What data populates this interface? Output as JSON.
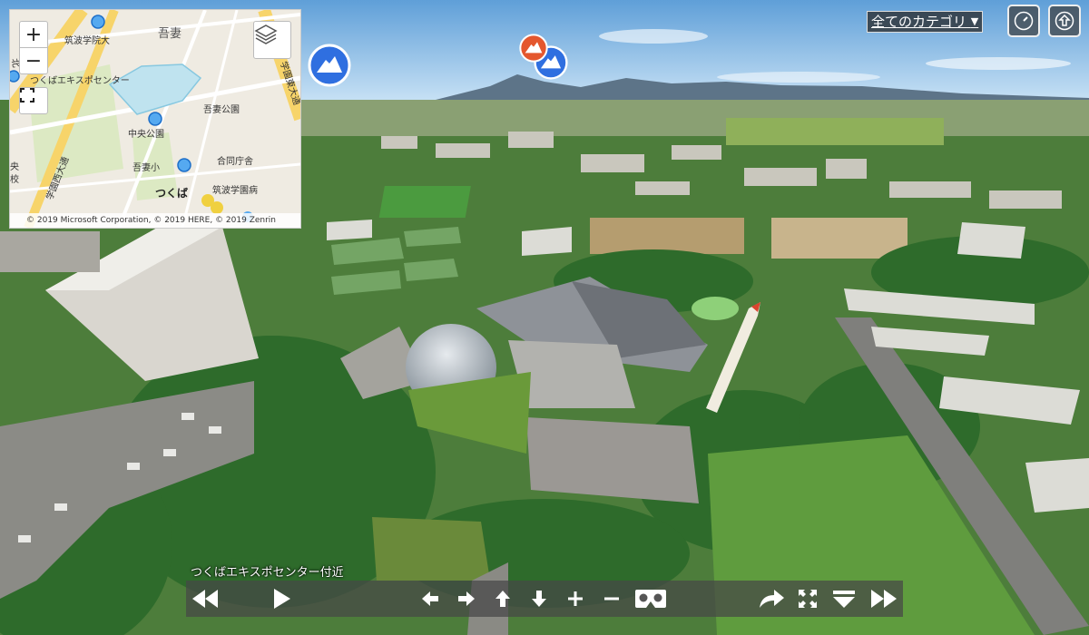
{
  "map": {
    "labels": {
      "tsukuba_gakuin": "筑波学院大",
      "azuma": "吾妻",
      "expo_center": "つくばエキスポセンター",
      "azuma_park": "吾妻公園",
      "central_park": "中央公園",
      "joint_office": "合同庁舎",
      "azuma_elementary": "吾妻小",
      "tsukuba_gakuen_hospital": "筑波学園病",
      "tsukuba": "つくば",
      "gakuen_nishi_odori": "学園西大通",
      "gakuen_higashi_odori": "学園東大通",
      "kita": "北",
      "school_left": "央",
      "school_left2": "校"
    },
    "zoom_in_label": "+",
    "zoom_out_label": "−",
    "attribution": "© 2019 Microsoft Corporation, © 2019 HERE, © 2019 Zenrin"
  },
  "category_select": {
    "value": "全てのカテゴリ",
    "arrow": "▼"
  },
  "top_buttons": [
    "compass-icon",
    "home-up-icon"
  ],
  "hotspots": [
    {
      "icon": "mountain-icon",
      "color": "#2f6fe0"
    },
    {
      "icon": "mountain-icon",
      "color": "#e4572e"
    },
    {
      "icon": "mountain-icon",
      "color": "#2f6fe0"
    }
  ],
  "caption": "つくばエキスポセンター付近",
  "toolbar": {
    "buttons": [
      "prev-scene-icon",
      "play-icon",
      "pan-left-icon",
      "pan-right-icon",
      "pan-up-icon",
      "pan-down-icon",
      "zoom-in-icon",
      "zoom-out-icon",
      "vr-icon",
      "share-icon",
      "fullscreen-icon",
      "collapse-menu-icon",
      "next-scene-icon"
    ]
  },
  "colors": {
    "sky": "#8cc2ef",
    "foliage": "#2e7d32",
    "hotspot_blue": "#2f6fe0",
    "hotspot_orange": "#e4572e",
    "toolbar_bg": "#464646"
  }
}
